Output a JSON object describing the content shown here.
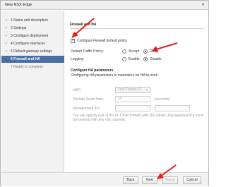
{
  "window": {
    "title": "New NSX Edge",
    "close_glyph": "✕"
  },
  "steps": [
    {
      "number": "1",
      "label": "Name and description",
      "status": "done"
    },
    {
      "number": "2",
      "label": "Settings",
      "status": "done"
    },
    {
      "number": "3",
      "label": "Configure deployment",
      "status": "done"
    },
    {
      "number": "4",
      "label": "Configure interfaces",
      "status": "done"
    },
    {
      "number": "5",
      "label": "Default gateway settings",
      "status": "done"
    },
    {
      "number": "6",
      "label": "Firewall and HA",
      "status": "active"
    },
    {
      "number": "7",
      "label": "Ready to complete",
      "status": "future"
    }
  ],
  "firewall": {
    "section_title": "Firewall and HA",
    "configure_label": "Configure Firewall default policy",
    "configure_checked": true,
    "traffic_policy_label": "Default Traffic Policy:",
    "accept_label": "Accept",
    "deny_label": "Deny",
    "traffic_policy_selected": "Deny",
    "logging_label": "Logging:",
    "enable_label": "Enable",
    "disable_label": "Disable",
    "logging_selected": "Disable"
  },
  "ha": {
    "title": "Configure HA parameters",
    "subtitle": "Configuring HA parameters is mandatory for HA to work.",
    "vnic_label": "vNIC:",
    "vnic_value": "Test-Transit-01",
    "dead_time_label": "Declare Dead Time:",
    "dead_time_value": "15",
    "dead_time_unit": "(seconds)",
    "mgmt_ips_label": "Management IPs:",
    "help_line1": "You can specify pair of IPs (in CIDR format) with /30 subnet. Management IPs must",
    "help_line2": "not overlap with any vnic subnets."
  },
  "footer": {
    "back": "Back",
    "next": "Next",
    "finish": "Finish",
    "cancel": "Cancel"
  },
  "colors": {
    "active_step": "#4a6fa5",
    "annotation_arrow": "#e02020"
  }
}
